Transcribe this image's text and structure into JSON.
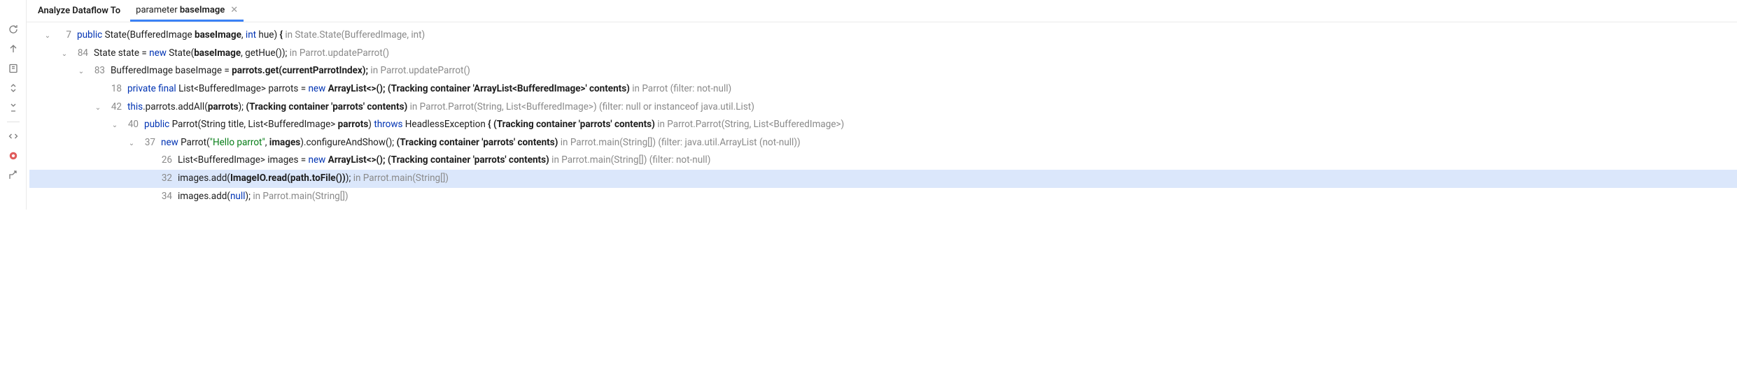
{
  "header": {
    "title": "Analyze Dataflow To",
    "tab": {
      "prefix": "parameter",
      "name": "baseImage"
    }
  },
  "rows": [
    {
      "indent": 0,
      "chev": "down",
      "selected": false,
      "ln": "7",
      "segments": [
        {
          "t": "kw",
          "v": "public"
        },
        {
          "t": "norm",
          "v": " State(BufferedImage "
        },
        {
          "t": "bold",
          "v": "baseImage"
        },
        {
          "t": "norm",
          "v": ", "
        },
        {
          "t": "kw",
          "v": "int"
        },
        {
          "t": "norm",
          "v": " hue) "
        },
        {
          "t": "bold",
          "v": "{"
        },
        {
          "t": "gray",
          "v": " in State.State(BufferedImage, int)"
        }
      ]
    },
    {
      "indent": 1,
      "chev": "down",
      "selected": false,
      "ln": "84",
      "segments": [
        {
          "t": "norm",
          "v": "State state = "
        },
        {
          "t": "kw",
          "v": "new"
        },
        {
          "t": "norm",
          "v": " State("
        },
        {
          "t": "bold",
          "v": "baseImage"
        },
        {
          "t": "norm",
          "v": ", getHue()); "
        },
        {
          "t": "gray",
          "v": "in Parrot.updateParrot()"
        }
      ]
    },
    {
      "indent": 2,
      "chev": "down",
      "selected": false,
      "ln": "83",
      "segments": [
        {
          "t": "norm",
          "v": "BufferedImage baseImage = "
        },
        {
          "t": "bold",
          "v": "parrots.get(currentParrotIndex);"
        },
        {
          "t": "gray",
          "v": " in Parrot.updateParrot()"
        }
      ]
    },
    {
      "indent": 3,
      "chev": "none",
      "selected": false,
      "ln": "18",
      "segments": [
        {
          "t": "kw",
          "v": "private final"
        },
        {
          "t": "norm",
          "v": " List<BufferedImage> parrots = "
        },
        {
          "t": "kw",
          "v": "new"
        },
        {
          "t": "norm",
          "v": " "
        },
        {
          "t": "bold",
          "v": "ArrayList<>(); (Tracking container 'ArrayList<BufferedImage>' contents)"
        },
        {
          "t": "gray",
          "v": " in Parrot (filter: not-null)"
        }
      ]
    },
    {
      "indent": 3,
      "chev": "down",
      "selected": false,
      "ln": "42",
      "segments": [
        {
          "t": "kw",
          "v": "this"
        },
        {
          "t": "norm",
          "v": ".parrots.addAll("
        },
        {
          "t": "bold",
          "v": "parrots"
        },
        {
          "t": "norm",
          "v": "); "
        },
        {
          "t": "bold",
          "v": "(Tracking container 'parrots' contents)"
        },
        {
          "t": "gray",
          "v": " in Parrot.Parrot(String, List<BufferedImage>) (filter: null or instanceof java.util.List)"
        }
      ]
    },
    {
      "indent": 4,
      "chev": "down",
      "selected": false,
      "ln": "40",
      "segments": [
        {
          "t": "kw",
          "v": "public"
        },
        {
          "t": "norm",
          "v": " Parrot(String title, List<BufferedImage> "
        },
        {
          "t": "bold",
          "v": "parrots"
        },
        {
          "t": "norm",
          "v": ") "
        },
        {
          "t": "kw",
          "v": "throws"
        },
        {
          "t": "norm",
          "v": " HeadlessException "
        },
        {
          "t": "bold",
          "v": "{ (Tracking container 'parrots' contents)"
        },
        {
          "t": "gray",
          "v": " in Parrot.Parrot(String, List<BufferedImage>)"
        }
      ]
    },
    {
      "indent": 5,
      "chev": "down",
      "selected": false,
      "ln": "37",
      "segments": [
        {
          "t": "kw",
          "v": "new"
        },
        {
          "t": "norm",
          "v": " Parrot("
        },
        {
          "t": "str",
          "v": "\"Hello parrot\""
        },
        {
          "t": "norm",
          "v": ", "
        },
        {
          "t": "bold",
          "v": "images"
        },
        {
          "t": "norm",
          "v": ").configureAndShow(); "
        },
        {
          "t": "bold",
          "v": "(Tracking container 'parrots' contents)"
        },
        {
          "t": "gray",
          "v": " in Parrot.main(String[]) (filter: java.util.ArrayList (not-null))"
        }
      ]
    },
    {
      "indent": 6,
      "chev": "none",
      "selected": false,
      "ln": "26",
      "segments": [
        {
          "t": "norm",
          "v": "List<BufferedImage> images = "
        },
        {
          "t": "kw",
          "v": "new"
        },
        {
          "t": "norm",
          "v": " "
        },
        {
          "t": "bold",
          "v": "ArrayList<>(); (Tracking container 'parrots' contents)"
        },
        {
          "t": "gray",
          "v": " in Parrot.main(String[]) (filter: not-null)"
        }
      ]
    },
    {
      "indent": 6,
      "chev": "none",
      "selected": true,
      "ln": "32",
      "segments": [
        {
          "t": "norm",
          "v": "images.add("
        },
        {
          "t": "bold",
          "v": "ImageIO.read(path.toFile())"
        },
        {
          "t": "norm",
          "v": "); "
        },
        {
          "t": "gray",
          "v": "in Parrot.main(String[])"
        }
      ]
    },
    {
      "indent": 6,
      "chev": "none",
      "selected": false,
      "ln": "34",
      "segments": [
        {
          "t": "norm",
          "v": "images.add("
        },
        {
          "t": "kw",
          "v": "null"
        },
        {
          "t": "norm",
          "v": "); "
        },
        {
          "t": "gray",
          "v": "in Parrot.main(String[])"
        }
      ]
    }
  ]
}
